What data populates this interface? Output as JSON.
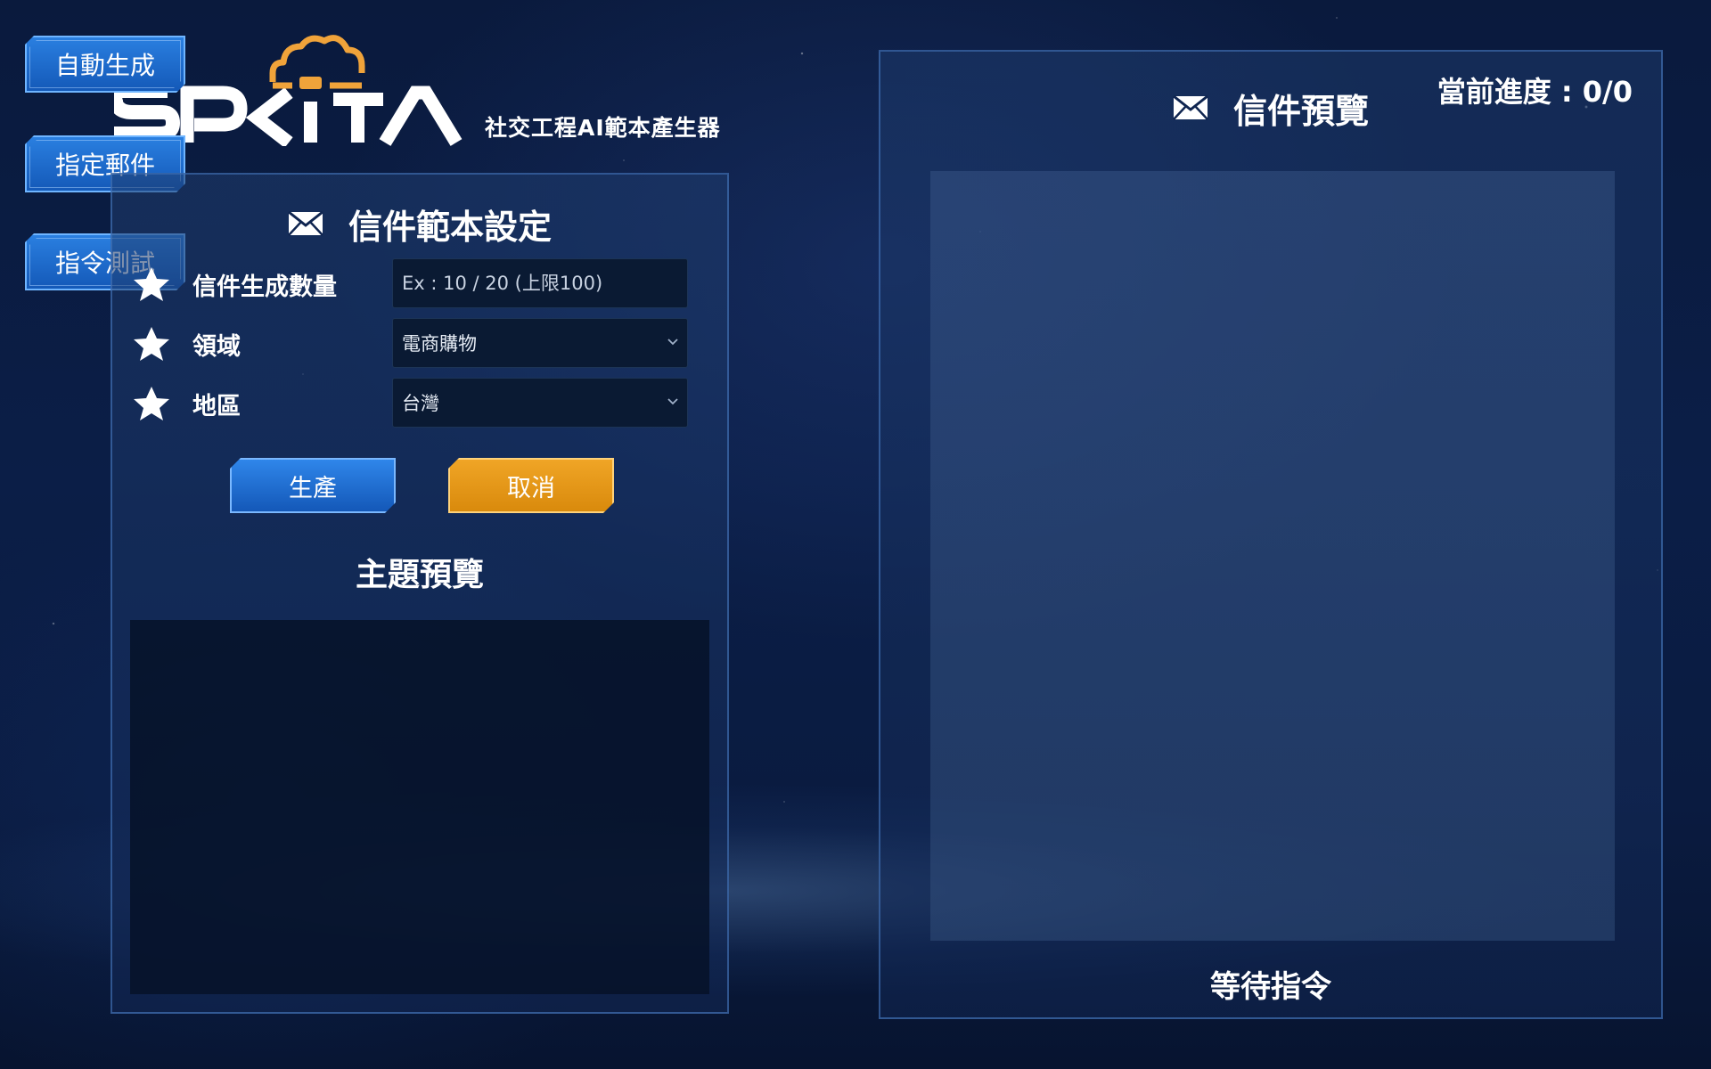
{
  "logo": {
    "brand": "SPKiTA",
    "subtitle": "社交工程AI範本產生器"
  },
  "side_nav": {
    "items": [
      {
        "label": "自動生成"
      },
      {
        "label": "指定郵件"
      },
      {
        "label": "指令測試"
      }
    ]
  },
  "template_settings": {
    "title": "信件範本設定",
    "title_icon": "mail-icon",
    "fields": {
      "count": {
        "label": "信件生成數量",
        "value": "",
        "placeholder": "Ex : 10 / 20 (上限100)"
      },
      "domain": {
        "label": "領域",
        "selected": "電商購物"
      },
      "region": {
        "label": "地區",
        "selected": "台灣"
      }
    },
    "produce_label": "生產",
    "cancel_label": "取消",
    "subject_preview_title": "主題預覽"
  },
  "mail_preview": {
    "title": "信件預覽",
    "title_icon": "mail-icon",
    "progress": "當前進度 : 0/0",
    "status": "等待指令"
  },
  "colors": {
    "primary_button": "#1f6fd6",
    "cancel_button": "#e49a17",
    "logo_cloud": "#f0a33a",
    "background": "#0a1b40"
  }
}
